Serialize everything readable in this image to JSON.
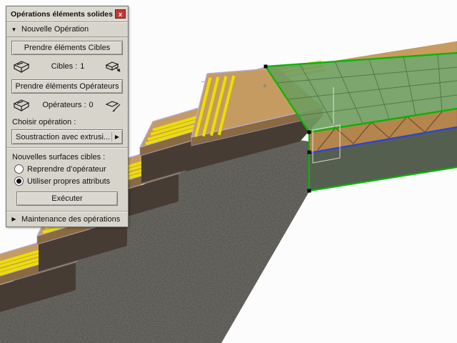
{
  "palette": {
    "title": "Opérations éléments solides",
    "icons": {
      "close": "x",
      "collapse": "▼",
      "expand": "▶",
      "dropdown_arrow": "▶"
    },
    "sections": {
      "new_operation": "Nouvelle Opération",
      "maintenance": "Maintenance des opérations"
    },
    "buttons": {
      "take_targets": "Prendre éléments Cibles",
      "take_operators": "Prendre éléments Opérateurs",
      "execute": "Exécuter"
    },
    "counters": {
      "targets_label": "Cibles :",
      "targets_value": "1",
      "operators_label": "Opérateurs :",
      "operators_value": "0"
    },
    "labels": {
      "choose_operation": "Choisir opération :",
      "new_target_surfaces": "Nouvelles surfaces cibles :"
    },
    "operation_selected": "Soustraction avec extrusi...",
    "radios": [
      {
        "label": "Reprendre d’opérateur",
        "selected": false
      },
      {
        "label": "Utiliser propres attributs",
        "selected": true
      }
    ]
  },
  "scene": {
    "description": "3D view: wooden stair with yellow safety stripes over concrete mass, selected slab highlighted",
    "colors": {
      "selection_green": "#00b800",
      "selection_blue": "#2946d8",
      "stripe_yellow": "#ecdf00",
      "wood": "#c69b62",
      "wood_dark": "#8a6a40",
      "concrete": "#52504a",
      "glass_green": "#6f9b5e",
      "outline_lavender": "#b6aee2",
      "band_dark": "#555f50"
    }
  }
}
